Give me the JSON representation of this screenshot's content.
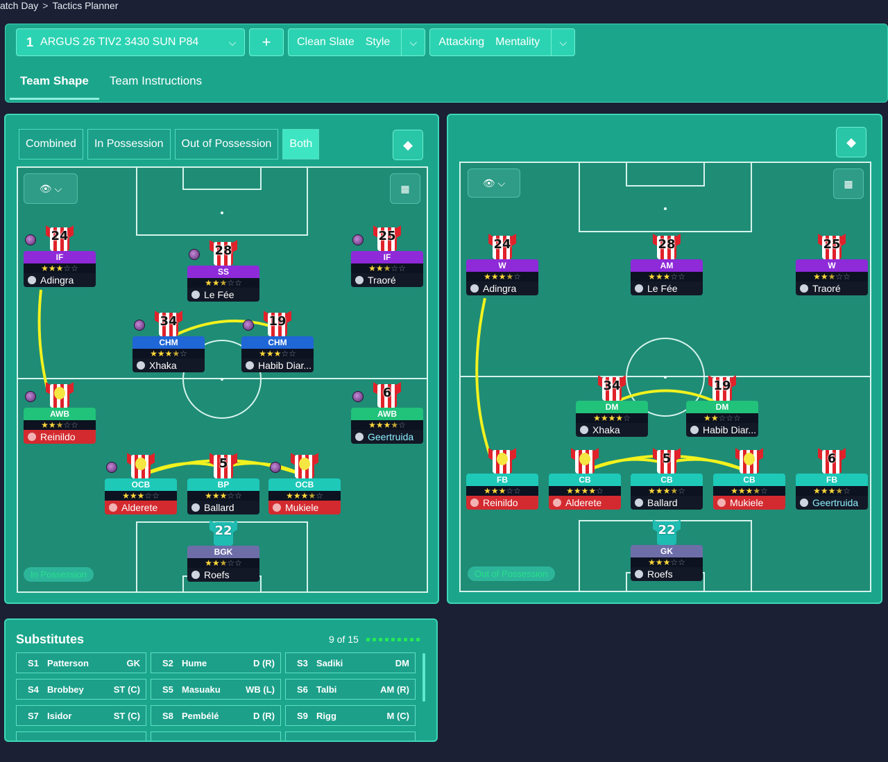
{
  "breadcrumb": {
    "items": [
      "atch Day",
      "Tactics Planner"
    ],
    "separator": ">"
  },
  "tactic": {
    "number": "1",
    "name": "ARGUS 26 TIV2 3430 SUN P84",
    "add_label": "+"
  },
  "style_group": {
    "value": "Clean Slate",
    "label": "Style"
  },
  "mentality_group": {
    "value": "Attacking",
    "label": "Mentality"
  },
  "tabs": [
    {
      "label": "Team Shape",
      "active": true
    },
    {
      "label": "Team Instructions",
      "active": false
    }
  ],
  "view_tabs": [
    {
      "label": "Combined",
      "active": false
    },
    {
      "label": "In Possession",
      "active": false
    },
    {
      "label": "Out of Possession",
      "active": false
    },
    {
      "label": "Both",
      "active": true
    }
  ],
  "left_pitch": {
    "phase_label": "In Possession",
    "players": [
      {
        "number": "24",
        "role": "IF",
        "role_color": "#8e2ad8",
        "stars": 3,
        "max": 5,
        "name": "Adingra",
        "name_style": "dark",
        "orb": true,
        "face": false,
        "gk": false
      },
      {
        "number": "28",
        "role": "SS",
        "role_color": "#8e2ad8",
        "stars": 2.5,
        "max": 5,
        "name": "Le Fée",
        "name_style": "dark",
        "orb": true,
        "face": false,
        "gk": false
      },
      {
        "number": "25",
        "role": "IF",
        "role_color": "#8e2ad8",
        "stars": 2.5,
        "max": 5,
        "name": "Traoré",
        "name_style": "dark",
        "orb": true,
        "face": false,
        "gk": false
      },
      {
        "number": "34",
        "role": "CHM",
        "role_color": "#1f66d6",
        "stars": 3.5,
        "max": 5,
        "name": "Xhaka",
        "name_style": "dark",
        "orb": true,
        "face": false,
        "gk": false
      },
      {
        "number": "19",
        "role": "CHM",
        "role_color": "#1f66d6",
        "stars": 3,
        "max": 5,
        "name": "Habib Diar...",
        "name_style": "dark",
        "orb": true,
        "face": false,
        "gk": false
      },
      {
        "number": "",
        "role": "AWB",
        "role_color": "#21c27a",
        "stars": 2.5,
        "max": 5,
        "name": "Reinildo",
        "name_style": "red",
        "orb": true,
        "face": true,
        "gk": false
      },
      {
        "number": "6",
        "role": "AWB",
        "role_color": "#21c27a",
        "stars": 3.5,
        "max": 5,
        "name": "Geertruida",
        "name_style": "cyan",
        "orb": true,
        "face": false,
        "gk": false
      },
      {
        "number": "",
        "role": "OCB",
        "role_color": "#1ec9b8",
        "stars": 3,
        "max": 5,
        "name": "Alderete",
        "name_style": "red",
        "orb": true,
        "face": true,
        "gk": false
      },
      {
        "number": "5",
        "role": "BP",
        "role_color": "#1ec9b8",
        "stars": 3,
        "max": 5,
        "name": "Ballard",
        "name_style": "dark",
        "orb": false,
        "face": false,
        "gk": false
      },
      {
        "number": "",
        "role": "OCB",
        "role_color": "#1ec9b8",
        "stars": 3.5,
        "max": 5,
        "name": "Mukiele",
        "name_style": "red",
        "orb": true,
        "face": true,
        "gk": false
      },
      {
        "number": "22",
        "role": "BGK",
        "role_color": "#6d6ea8",
        "stars": 2.5,
        "max": 5,
        "name": "Roefs",
        "name_style": "dark",
        "orb": false,
        "face": false,
        "gk": true
      }
    ]
  },
  "right_pitch": {
    "phase_label": "Out of Possession",
    "players": [
      {
        "number": "24",
        "role": "W",
        "role_color": "#8e2ad8",
        "stars": 3.5,
        "max": 5,
        "name": "Adingra",
        "name_style": "dark",
        "orb": false,
        "face": false,
        "gk": false
      },
      {
        "number": "28",
        "role": "AM",
        "role_color": "#8e2ad8",
        "stars": 3,
        "max": 5,
        "name": "Le Fée",
        "name_style": "dark",
        "orb": false,
        "face": false,
        "gk": false
      },
      {
        "number": "25",
        "role": "W",
        "role_color": "#8e2ad8",
        "stars": 2.5,
        "max": 5,
        "name": "Traoré",
        "name_style": "dark",
        "orb": false,
        "face": false,
        "gk": false
      },
      {
        "number": "34",
        "role": "DM",
        "role_color": "#21c27a",
        "stars": 4,
        "max": 5,
        "name": "Xhaka",
        "name_style": "dark",
        "orb": false,
        "face": false,
        "gk": false
      },
      {
        "number": "19",
        "role": "DM",
        "role_color": "#21c27a",
        "stars": 2,
        "max": 5,
        "name": "Habib Diar...",
        "name_style": "dark",
        "orb": false,
        "face": false,
        "gk": false
      },
      {
        "number": "",
        "role": "FB",
        "role_color": "#1ec9b8",
        "stars": 3,
        "max": 5,
        "name": "Reinildo",
        "name_style": "red",
        "orb": false,
        "face": true,
        "gk": false
      },
      {
        "number": "",
        "role": "CB",
        "role_color": "#1ec9b8",
        "stars": 4,
        "max": 5,
        "name": "Alderete",
        "name_style": "red",
        "orb": false,
        "face": true,
        "gk": false
      },
      {
        "number": "5",
        "role": "CB",
        "role_color": "#1ec9b8",
        "stars": 3.5,
        "max": 5,
        "name": "Ballard",
        "name_style": "dark",
        "orb": false,
        "face": false,
        "gk": false
      },
      {
        "number": "",
        "role": "CB",
        "role_color": "#1ec9b8",
        "stars": 3.5,
        "max": 5,
        "name": "Mukiele",
        "name_style": "red",
        "orb": false,
        "face": true,
        "gk": false
      },
      {
        "number": "6",
        "role": "FB",
        "role_color": "#1ec9b8",
        "stars": 3.5,
        "max": 5,
        "name": "Geertruida",
        "name_style": "cyan",
        "orb": false,
        "face": false,
        "gk": false
      },
      {
        "number": "22",
        "role": "GK",
        "role_color": "#6d6ea8",
        "stars": 3,
        "max": 5,
        "name": "Roefs",
        "name_style": "dark",
        "orb": false,
        "face": false,
        "gk": true
      }
    ]
  },
  "substitutes": {
    "title": "Substitutes",
    "count": "9 of 15",
    "items": [
      {
        "id": "S1",
        "name": "Patterson",
        "pos": "GK"
      },
      {
        "id": "S2",
        "name": "Hume",
        "pos": "D (R)"
      },
      {
        "id": "S3",
        "name": "Sadiki",
        "pos": "DM"
      },
      {
        "id": "S4",
        "name": "Brobbey",
        "pos": "ST (C)"
      },
      {
        "id": "S5",
        "name": "Masuaku",
        "pos": "WB (L)"
      },
      {
        "id": "S6",
        "name": "Talbi",
        "pos": "AM (R)"
      },
      {
        "id": "S7",
        "name": "Isidor",
        "pos": "ST (C)"
      },
      {
        "id": "S8",
        "name": "Pembélé",
        "pos": "D (R)"
      },
      {
        "id": "S9",
        "name": "Rigg",
        "pos": "M (C)"
      }
    ]
  },
  "colors": {
    "panel": "#1ba68c",
    "pitch": "#1f8c76",
    "link": "#f2f21e",
    "background": "#1b2035"
  },
  "icons": {
    "view": "eye-icon",
    "grid": "grid-icon",
    "diamond": "diamond-icon",
    "chevron": "chevron-down-icon"
  }
}
